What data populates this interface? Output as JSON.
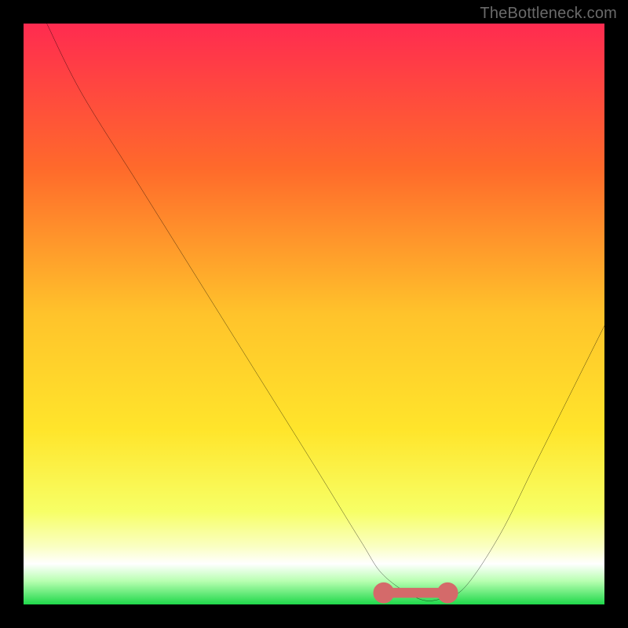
{
  "watermark": "TheBottleneck.com",
  "colors": {
    "bg": "#000000",
    "grad_top": "#ff2b50",
    "grad_mid1": "#ff8a2b",
    "grad_mid2": "#ffe52b",
    "grad_bottom_yellow": "#f7ff66",
    "grad_bottom_white": "#ffffff",
    "grad_bottom_green": "#1fd84a",
    "curve": "#000000",
    "segment": "#d46a6a"
  },
  "chart_data": {
    "type": "line",
    "title": "",
    "xlabel": "",
    "ylabel": "",
    "xlim": [
      0,
      100
    ],
    "ylim": [
      0,
      100
    ],
    "series": [
      {
        "name": "curve",
        "x": [
          4,
          10,
          20,
          30,
          40,
          50,
          58,
          62,
          68,
          72,
          76,
          82,
          88,
          94,
          100
        ],
        "values": [
          100,
          88,
          72,
          56,
          40,
          24,
          11,
          5,
          1,
          1,
          3,
          12,
          24,
          36,
          48
        ]
      }
    ],
    "highlight_segment": {
      "note": "flat pink segment near the valley bottom",
      "x_start": 62,
      "x_end": 73,
      "y": 2
    }
  }
}
